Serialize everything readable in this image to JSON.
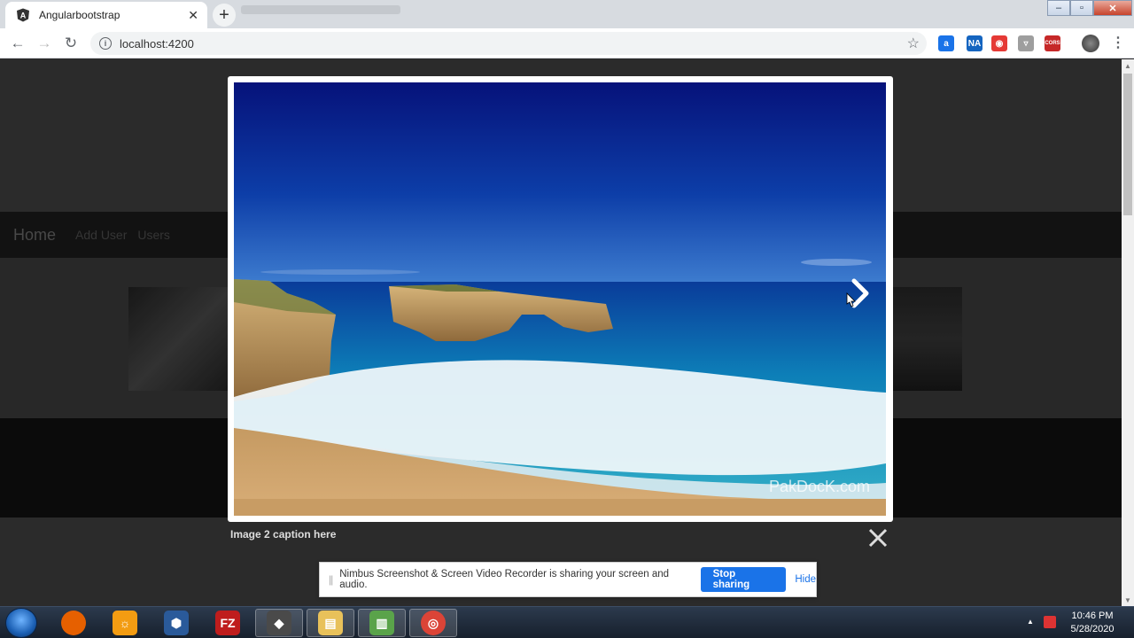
{
  "browser": {
    "tab_title": "Angularbootstrap",
    "tab_close": "✕",
    "new_tab": "+",
    "url": "localhost:4200",
    "window_controls": {
      "minimize": "‒",
      "maximize": "▫",
      "close": "✕"
    },
    "extensions": [
      {
        "icon": "extension-a-icon",
        "label": "a",
        "color": "#1a73e8"
      },
      {
        "icon": "extension-na-icon",
        "label": "NA",
        "color": "#1565c0"
      },
      {
        "icon": "extension-record-icon",
        "label": "◉",
        "color": "#e53935"
      },
      {
        "icon": "extension-shield-icon",
        "label": "▿",
        "color": "#9e9e9e"
      },
      {
        "icon": "extension-cors-icon",
        "label": "CORS",
        "color": "#c62828"
      }
    ]
  },
  "page": {
    "brand": "Home",
    "nav_links": [
      "Add User",
      "Users"
    ]
  },
  "lightbox": {
    "caption": "Image 2 caption here",
    "watermark": "PakDocK.com",
    "next_icon": "chevron-right-icon",
    "close_icon": "close-icon"
  },
  "share_bar": {
    "message": "Nimbus Screenshot & Screen Video Recorder is sharing your screen and audio.",
    "stop_label": "Stop sharing",
    "hide_label": "Hide"
  },
  "taskbar": {
    "apps": [
      {
        "name": "firefox",
        "label": "",
        "color": "#e66000"
      },
      {
        "name": "app-orange",
        "label": "☼",
        "color": "#f39c12"
      },
      {
        "name": "app-blue-hex",
        "label": "⬢",
        "color": "#2a5a9a"
      },
      {
        "name": "filezilla",
        "label": "FZ",
        "color": "#bf1d1d"
      },
      {
        "name": "git-app",
        "label": "◆",
        "color": "#4a4a4a"
      },
      {
        "name": "file-explorer",
        "label": "▤",
        "color": "#e8c15a"
      },
      {
        "name": "task-manager",
        "label": "▥",
        "color": "#5aa34a"
      },
      {
        "name": "chrome",
        "label": "◎",
        "color": "#db4437"
      }
    ],
    "time": "10:46 PM",
    "date": "5/28/2020"
  }
}
